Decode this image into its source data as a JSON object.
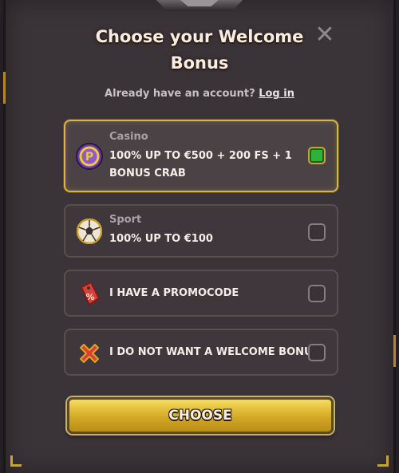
{
  "modal": {
    "title_line1": "Choose your Welcome",
    "title_line2": "Bonus",
    "close_icon": "close-icon",
    "login_prompt": "Already have an account?",
    "login_link": "Log in"
  },
  "options": [
    {
      "icon": "casino-chip-icon",
      "category": "Casino",
      "text": "100% UP TO €500 + 200 FS + 1 BONUS CRAB",
      "selected": true
    },
    {
      "icon": "soccer-ball-icon",
      "category": "Sport",
      "text": "100% UP TO €100",
      "selected": false
    },
    {
      "icon": "promo-tag-icon",
      "category": "",
      "text": "I HAVE A PROMOCODE",
      "selected": false
    },
    {
      "icon": "red-x-icon",
      "category": "",
      "text": "I DO NOT WANT A WELCOME BONUS",
      "selected": false
    }
  ],
  "choose_button": {
    "label": "CHOOSE"
  },
  "colors": {
    "accent_gold": "#d9b44a",
    "check_green": "#2db23a",
    "panel_bg": "#3a3337"
  }
}
